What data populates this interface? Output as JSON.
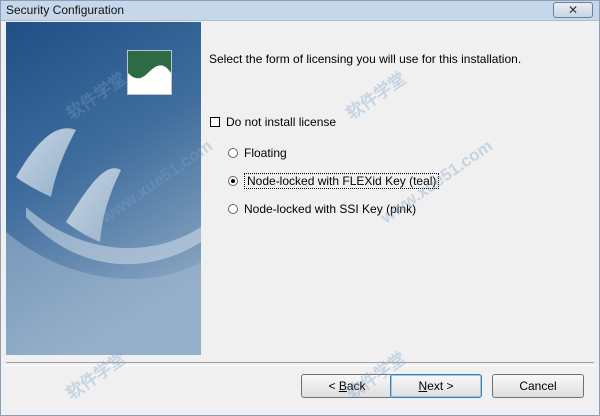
{
  "window": {
    "title": "Security Configuration",
    "close_glyph": "✕"
  },
  "prompt": "Select the form of licensing you will use for this installation.",
  "checkbox": {
    "label": "Do not install license",
    "checked": false
  },
  "radios": [
    {
      "label": "Floating",
      "selected": false
    },
    {
      "label": "Node-locked with FLEXid Key (teal)",
      "selected": true
    },
    {
      "label": "Node-locked with SSI Key (pink)",
      "selected": false
    }
  ],
  "buttons": {
    "back_prefix": "< ",
    "back_underlined": "B",
    "back_rest": "ack",
    "next_underlined": "N",
    "next_rest": "ext >",
    "cancel": "Cancel"
  },
  "watermark": {
    "cn": "软件学堂",
    "site": "www.xue51.com"
  },
  "colors": {
    "side_panel_top": "#2f5f92",
    "side_panel_bottom": "#6f8fb0",
    "logo_green": "#2e6b45"
  }
}
